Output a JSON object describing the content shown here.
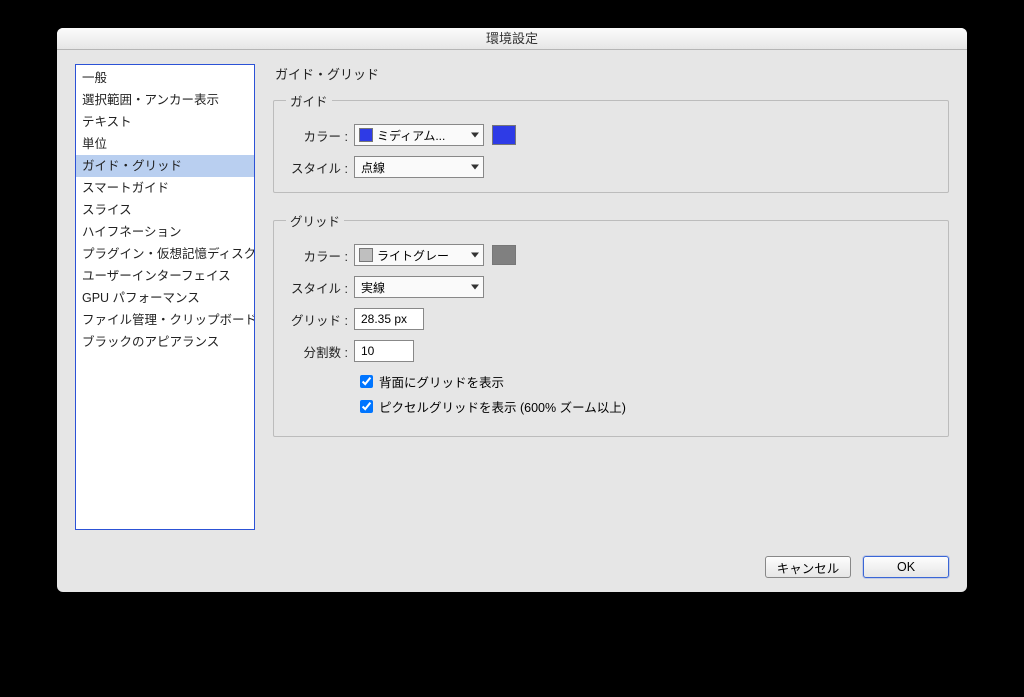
{
  "window": {
    "title": "環境設定"
  },
  "sidebar": {
    "items": [
      {
        "label": "一般",
        "selected": false
      },
      {
        "label": "選択範囲・アンカー表示",
        "selected": false
      },
      {
        "label": "テキスト",
        "selected": false
      },
      {
        "label": "単位",
        "selected": false
      },
      {
        "label": "ガイド・グリッド",
        "selected": true
      },
      {
        "label": "スマートガイド",
        "selected": false
      },
      {
        "label": "スライス",
        "selected": false
      },
      {
        "label": "ハイフネーション",
        "selected": false
      },
      {
        "label": "プラグイン・仮想記憶ディスク",
        "selected": false
      },
      {
        "label": "ユーザーインターフェイス",
        "selected": false
      },
      {
        "label": "GPU パフォーマンス",
        "selected": false
      },
      {
        "label": "ファイル管理・クリップボード",
        "selected": false
      },
      {
        "label": "ブラックのアピアランス",
        "selected": false
      }
    ]
  },
  "main": {
    "title": "ガイド・グリッド",
    "guide": {
      "legend": "ガイド",
      "color_label": "カラー :",
      "color_value": "ミディアム...",
      "color_swatch": "#2e3be6",
      "color_preview": "#2e3be6",
      "style_label": "スタイル :",
      "style_value": "点線"
    },
    "grid": {
      "legend": "グリッド",
      "color_label": "カラー :",
      "color_value": "ライトグレー",
      "color_swatch": "#bfbfbf",
      "color_preview": "#808080",
      "style_label": "スタイル :",
      "style_value": "実線",
      "spacing_label": "グリッド :",
      "spacing_value": "28.35 px",
      "subdiv_label": "分割数 :",
      "subdiv_value": "10",
      "cb_back_label": "背面にグリッドを表示",
      "cb_back_checked": true,
      "cb_pixel_label": "ピクセルグリッドを表示 (600% ズーム以上)",
      "cb_pixel_checked": true
    }
  },
  "footer": {
    "cancel": "キャンセル",
    "ok": "OK"
  }
}
